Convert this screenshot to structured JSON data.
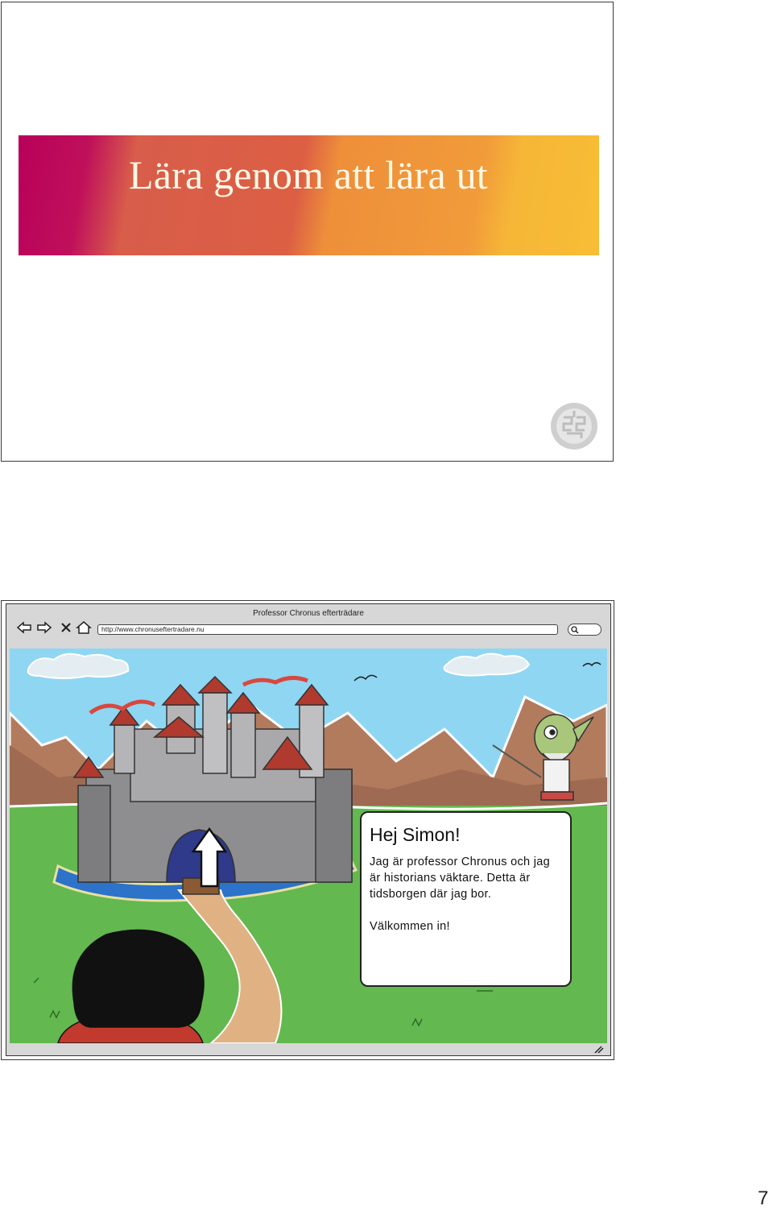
{
  "slide1": {
    "title": "Lära genom att lära ut",
    "seal_icon": "university-seal-icon"
  },
  "browser": {
    "window_title": "Professor Chronus efterträdare",
    "url": "http://www.chronuseftertradare.nu",
    "nav_icons": [
      "back-arrow-icon",
      "forward-arrow-icon",
      "close-icon",
      "home-icon"
    ],
    "search_icon": "search-icon"
  },
  "speech_bubble": {
    "greeting": "Hej Simon!",
    "text": "Jag är professor Chronus och jag är historians väktare. Detta är tidsborgen där jag bor.",
    "welcome": "Välkommen in!"
  },
  "colors": {
    "sky": "#8fd6f2",
    "grass": "#63b84f",
    "band_start": "#b8005a",
    "band_end": "#f8bd36"
  },
  "page_number": "7"
}
